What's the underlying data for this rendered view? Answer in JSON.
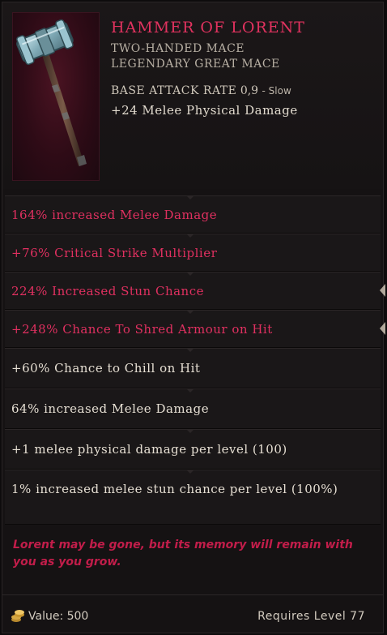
{
  "item": {
    "name": "Hammer of Lorent",
    "type": "Two-Handed Mace",
    "base": "Legendary Great Mace",
    "attack_rate_label": "Base Attack Rate",
    "attack_rate_value": "0,9",
    "attack_rate_speed": "- Slow",
    "implicit": "+24 Melee Physical Damage"
  },
  "affixes": [
    {
      "text": "164% increased Melee Damage"
    },
    {
      "text": "+76% Critical Strike Multiplier"
    },
    {
      "text": "224% Increased Stun Chance"
    },
    {
      "text": "+248% Chance To Shred Armour on Hit"
    },
    {
      "text": "+60% Chance to Chill on Hit"
    },
    {
      "text": "64% increased Melee Damage"
    },
    {
      "text": "+1 melee physical damage per level (100)"
    },
    {
      "text": "1% increased melee stun chance per level (100%)"
    }
  ],
  "lore": "Lorent may be gone, but its memory will remain with you as you grow.",
  "footer": {
    "value_label": "Value: 500",
    "requires": "Requires Level 77"
  },
  "colors": {
    "legendary_red": "#e03060",
    "lore_red": "#c21d4a",
    "text_white": "#e6dfd3"
  },
  "icons": [
    "hammer-icon",
    "coin-stack-icon",
    "scroll-arrow-icon"
  ]
}
